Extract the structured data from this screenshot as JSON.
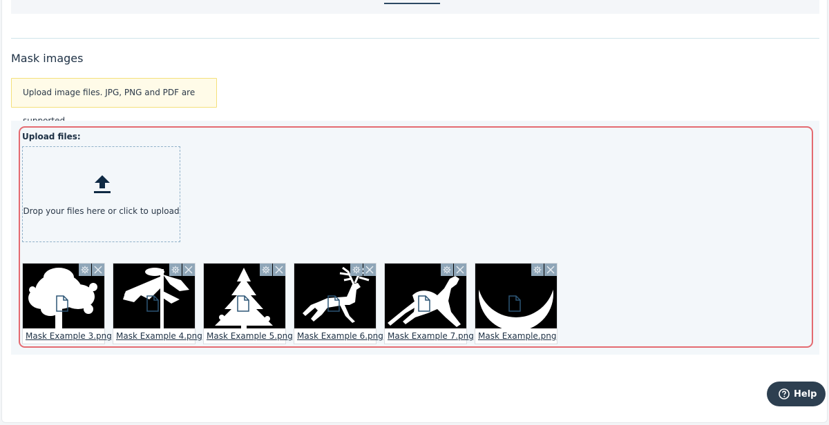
{
  "section": {
    "title": "Mask images",
    "notice": "Upload image files. JPG, PNG and PDF are supported."
  },
  "uploader": {
    "label": "Upload files:",
    "drop_text": "Drop your files here or click to upload",
    "upload_icon": "upload-icon"
  },
  "files": [
    {
      "name": "Mask Example 3.png",
      "shape": "tree"
    },
    {
      "name": "Mask Example 4.png",
      "shape": "branch"
    },
    {
      "name": "Mask Example 5.png",
      "shape": "pine"
    },
    {
      "name": "Mask Example 6.png",
      "shape": "deer"
    },
    {
      "name": "Mask Example 7.png",
      "shape": "kangaroo"
    },
    {
      "name": "Mask Example.png",
      "shape": "moon"
    }
  ],
  "file_tools": {
    "settings_icon": "gear-icon",
    "remove_icon": "close-icon"
  },
  "help": {
    "label": "Help",
    "icon": "help-icon"
  },
  "colors": {
    "highlight": "#e46a70",
    "help_bg": "#2d3f50",
    "notice_bg": "#fffbe8",
    "notice_border": "#f4e07a"
  }
}
